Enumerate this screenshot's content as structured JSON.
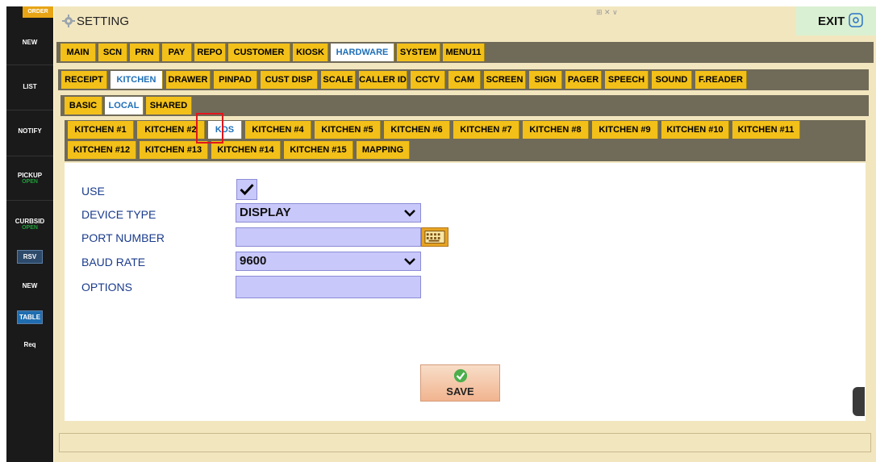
{
  "sidebar": {
    "order_tab": "ORDER",
    "items": [
      {
        "label": "NEW"
      },
      {
        "label": "LIST"
      },
      {
        "label": "NOTIFY"
      },
      {
        "label": "PICKUP",
        "status": "OPEN"
      },
      {
        "label": "CURBSID",
        "status": "OPEN"
      },
      {
        "label": "RSV"
      },
      {
        "label": "NEW"
      },
      {
        "label": "TABLE"
      },
      {
        "label": "Req"
      }
    ]
  },
  "header": {
    "title": "SETTING",
    "exit_label": "EXIT",
    "mini_control": "⊞ ✕ ∨"
  },
  "tabs_main": [
    "MAIN",
    "SCN",
    "PRN",
    "PAY",
    "REPO",
    "CUSTOMER",
    "KIOSK",
    "HARDWARE",
    "SYSTEM",
    "MENU11"
  ],
  "tabs_hardware": [
    "RECEIPT",
    "KITCHEN",
    "DRAWER",
    "PINPAD",
    "CUST DISP",
    "SCALE",
    "CALLER ID",
    "CCTV",
    "CAM",
    "SCREEN",
    "SIGN",
    "PAGER",
    "SPEECH",
    "SOUND",
    "F.READER"
  ],
  "tabs_kitchen": [
    "BASIC",
    "LOCAL",
    "SHARED"
  ],
  "tabs_devices_row1": [
    "KITCHEN #1",
    "KITCHEN #2",
    "KDS",
    "KITCHEN #4",
    "KITCHEN #5",
    "KITCHEN #6",
    "KITCHEN #7",
    "KITCHEN #8",
    "KITCHEN #9",
    "KITCHEN #10",
    "KITCHEN #11"
  ],
  "tabs_devices_row2": [
    "KITCHEN #12",
    "KITCHEN #13",
    "KITCHEN #14",
    "KITCHEN #15",
    "MAPPING"
  ],
  "active": {
    "main": "HARDWARE",
    "hardware": "KITCHEN",
    "kitchen": "LOCAL",
    "device": "KDS"
  },
  "form": {
    "use_label": "USE",
    "use_checked": true,
    "device_type_label": "DEVICE TYPE",
    "device_type_value": "DISPLAY",
    "port_number_label": "PORT NUMBER",
    "port_number_value": "",
    "baud_rate_label": "BAUD RATE",
    "baud_rate_value": "9600",
    "options_label": "OPTIONS",
    "options_value": ""
  },
  "save_label": "SAVE",
  "colors": {
    "tab": "#f2c018",
    "tab_active_text": "#1e6fb8",
    "bar": "#706a58",
    "window_bg": "#f2e6bf",
    "field_bg": "#c8c8fa",
    "label_text": "#1a3b8c",
    "highlight": "#e0161c",
    "exit_bg": "#d9f0d2"
  },
  "icons": [
    "gear-icon",
    "screenshot-icon",
    "chevron-down-icon",
    "keyboard-icon",
    "checkmark-icon",
    "check-circle-icon"
  ]
}
